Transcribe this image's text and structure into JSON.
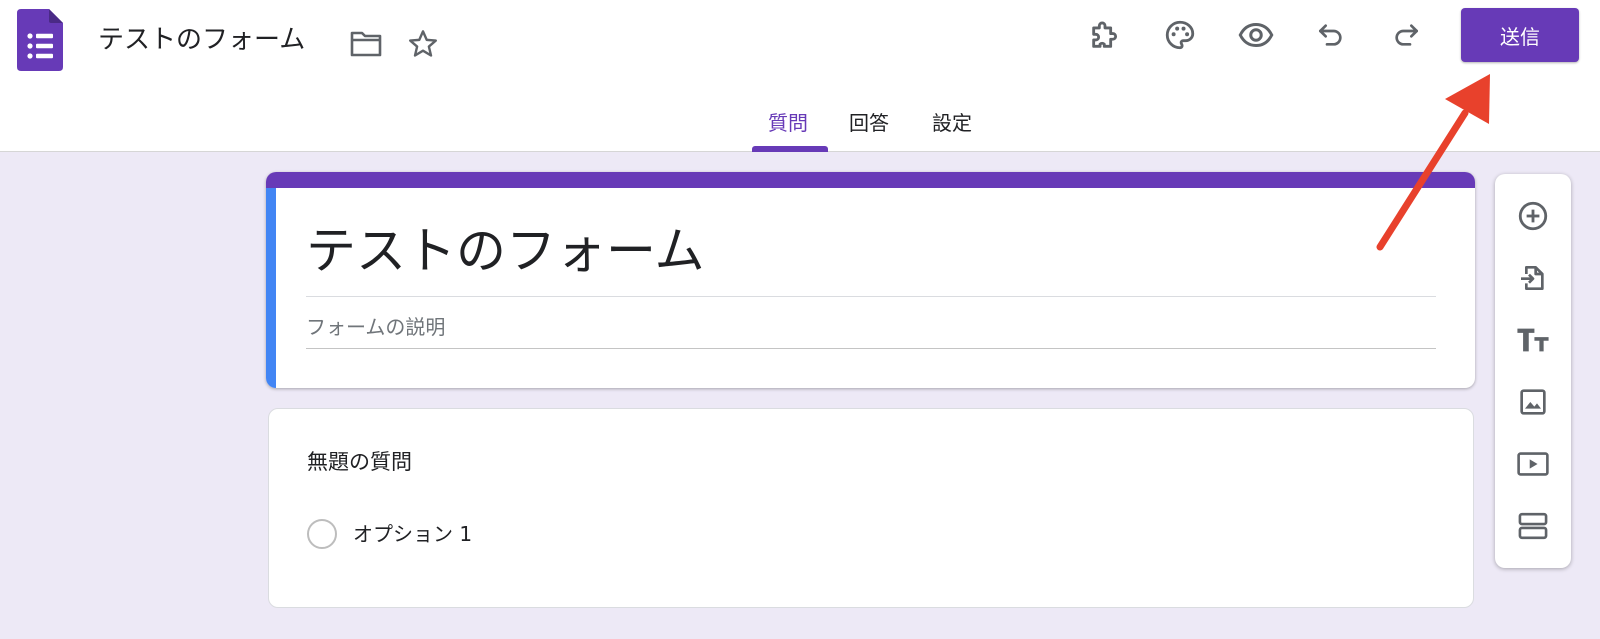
{
  "header": {
    "doc_title": "テストのフォーム",
    "send_label": "送信"
  },
  "tabs": [
    {
      "label": "質問",
      "active": true
    },
    {
      "label": "回答",
      "active": false
    },
    {
      "label": "設定",
      "active": false
    }
  ],
  "form": {
    "title": "テストのフォーム",
    "description_placeholder": "フォームの説明"
  },
  "question": {
    "title": "無題の質問",
    "options": [
      "オプション 1"
    ]
  },
  "colors": {
    "accent": "#673ab7",
    "title_stripe_left": "#4285f4",
    "background": "#ede9f6",
    "annotation_arrow": "#e8412c"
  },
  "icons": {
    "header": [
      "forms-logo-icon",
      "folder-icon",
      "star-icon",
      "addon-puzzle-icon",
      "palette-icon",
      "eye-preview-icon",
      "undo-icon",
      "redo-icon"
    ],
    "side_toolbar": [
      "add-question-icon",
      "import-questions-icon",
      "add-title-icon",
      "add-image-icon",
      "add-video-icon",
      "add-section-icon"
    ]
  }
}
